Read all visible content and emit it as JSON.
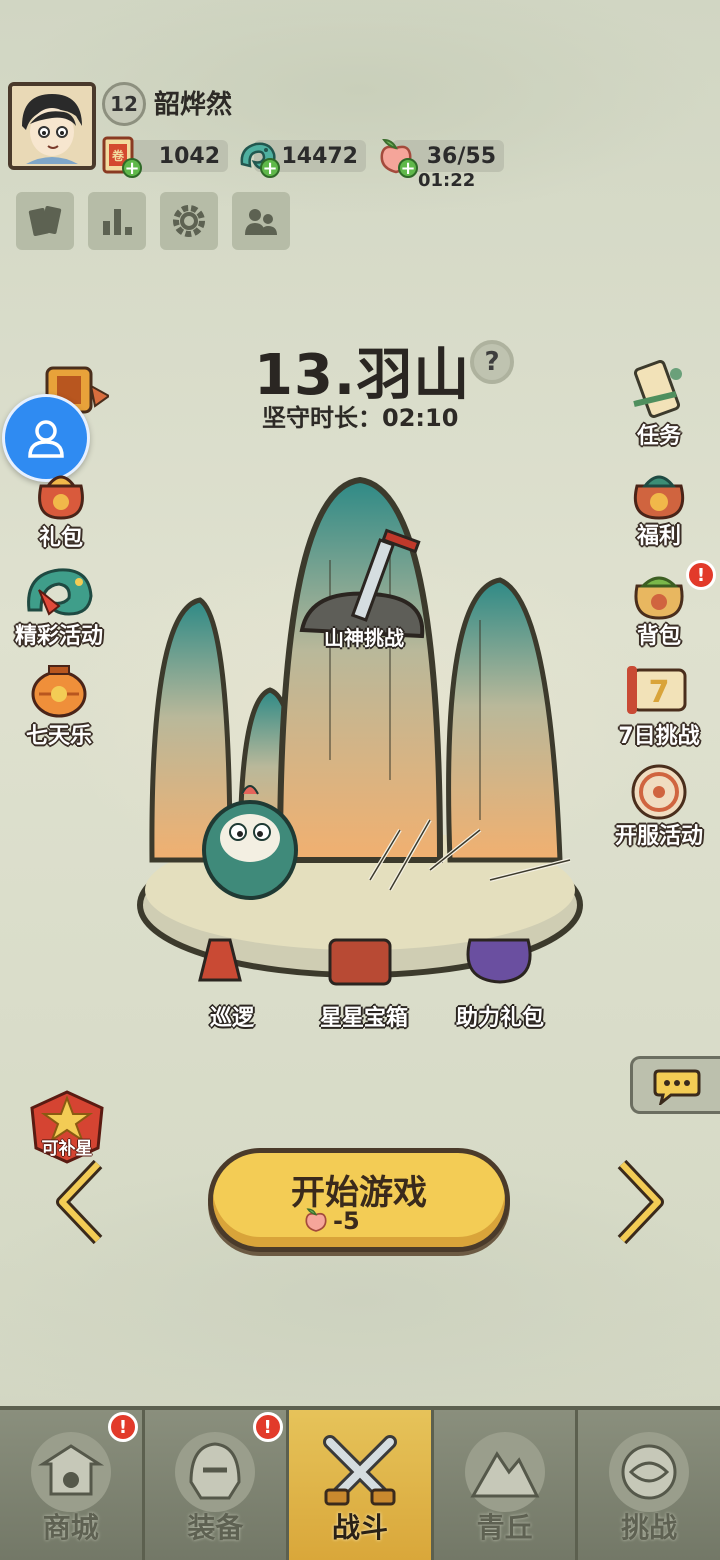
{
  "player": {
    "level": "12",
    "name": "韶烨然"
  },
  "resources": {
    "scroll": "1042",
    "jade": "14472",
    "stamina": "36/55",
    "stamina_timer": "01:22"
  },
  "toolbar": [
    "cards-icon",
    "rank-icon",
    "settings-icon",
    "friends-icon"
  ],
  "stage": {
    "title": "13.羽山",
    "guard_time": "坚守时长：02:10",
    "challenge_label": "山神挑战"
  },
  "left_menu": {
    "gift": "礼包",
    "events": "精彩活动",
    "seven_day": "七天乐"
  },
  "right_menu": {
    "tasks": "任务",
    "welfare": "福利",
    "bag": "背包",
    "seven_challenge": "7日挑战",
    "server_event": "开服活动"
  },
  "scene_items": {
    "patrol": "巡逻",
    "star_chest": "星星宝箱",
    "help_gift": "助力礼包"
  },
  "star_badge": "可补星",
  "start": {
    "label": "开始游戏",
    "cost": "-5"
  },
  "nav": {
    "shop": "商城",
    "equip": "装备",
    "battle": "战斗",
    "qingqiu": "青丘",
    "challenge": "挑战"
  },
  "colors": {
    "accent": "#f3cc55",
    "alert": "#e23a2a",
    "nav_bg": "#7a7f6e"
  }
}
